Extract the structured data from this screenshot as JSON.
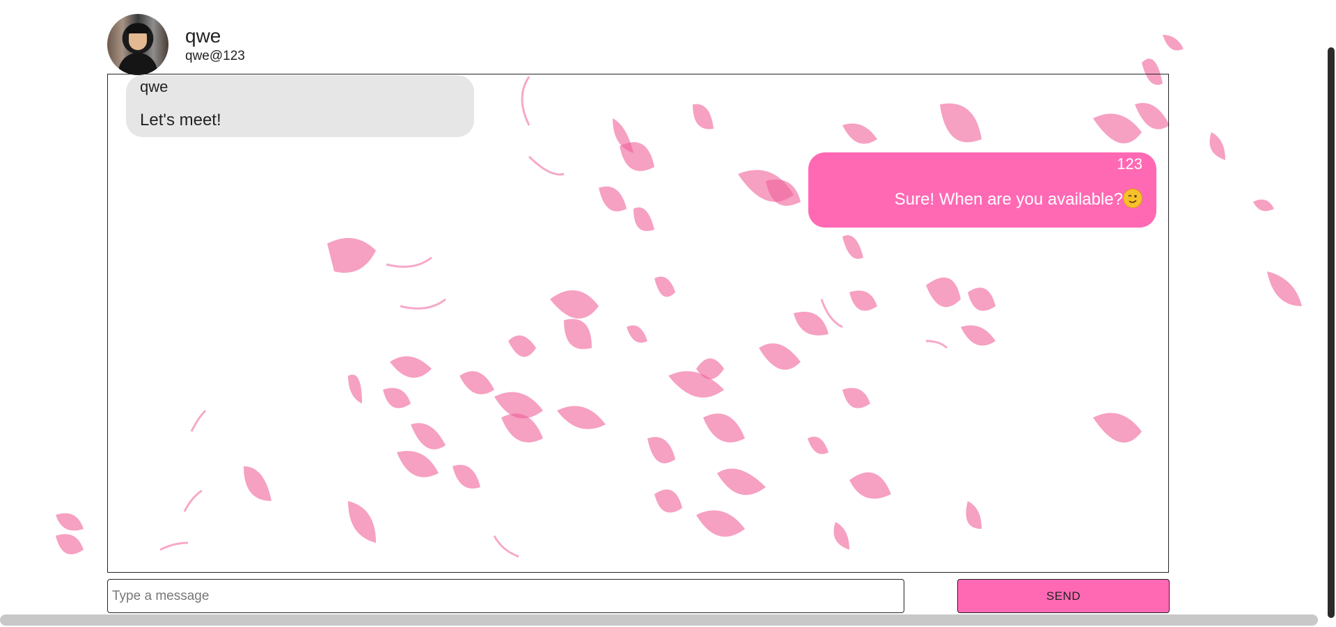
{
  "profile": {
    "name": "qwe",
    "handle": "qwe@123",
    "avatar_icon": "user-photo"
  },
  "messages": [
    {
      "direction": "incoming",
      "sender": "qwe",
      "text": "Let's meet!"
    },
    {
      "direction": "outgoing",
      "sender": "123",
      "text": "Sure! When are you available?",
      "emoji": "winking-face-icon"
    }
  ],
  "composer": {
    "placeholder": "Type a message",
    "send_label": "SEND"
  },
  "colors": {
    "accent": "#ff69b4",
    "incoming_bubble": "#e6e6e6",
    "petal": "#f0609a"
  }
}
